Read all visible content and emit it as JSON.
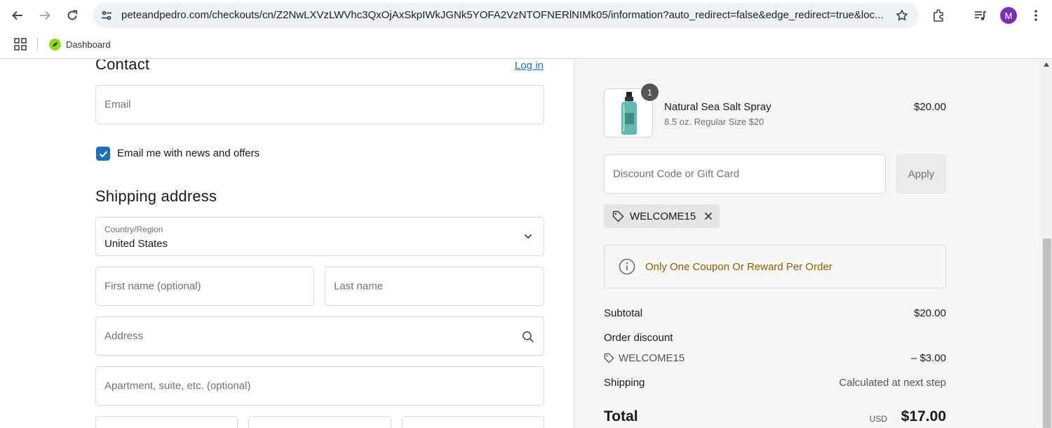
{
  "browser": {
    "url": "peteandpedro.com/checkouts/cn/Z2NwLXVzLWVhc3QxOjAxSkpIWkJGNk5YOFA2VzNTOFNERlNIMk05/information?auto_redirect=false&edge_redirect=true&loc...",
    "profile_initial": "M",
    "bookmark_label": "Dashboard"
  },
  "contact": {
    "heading": "Contact",
    "login_link": "Log in",
    "email_placeholder": "Email",
    "newsletter_label": "Email me with news and offers",
    "newsletter_checked": true
  },
  "shipping": {
    "heading": "Shipping address",
    "country_label": "Country/Region",
    "country_value": "United States",
    "first_name_placeholder": "First name (optional)",
    "last_name_placeholder": "Last name",
    "address_placeholder": "Address",
    "apartment_placeholder": "Apartment, suite, etc. (optional)"
  },
  "summary": {
    "product": {
      "name": "Natural Sea Salt Spray",
      "variant": "8.5 oz. Regular Size $20",
      "price": "$20.00",
      "quantity": "1"
    },
    "discount_placeholder": "Discount Code or Gift Card",
    "apply_label": "Apply",
    "applied_code": "WELCOME15",
    "notice": "Only One Coupon Or Reward Per Order",
    "subtotal_label": "Subtotal",
    "subtotal_value": "$20.00",
    "order_discount_label": "Order discount",
    "discount_code": "WELCOME15",
    "discount_value": "– $3.00",
    "shipping_label": "Shipping",
    "shipping_value": "Calculated at next step",
    "total_label": "Total",
    "currency": "USD",
    "total_value": "$17.00"
  },
  "colors": {
    "accent": "#1d6fb8",
    "notice_text": "#8a6100",
    "avatar": "#7a2fb3"
  }
}
